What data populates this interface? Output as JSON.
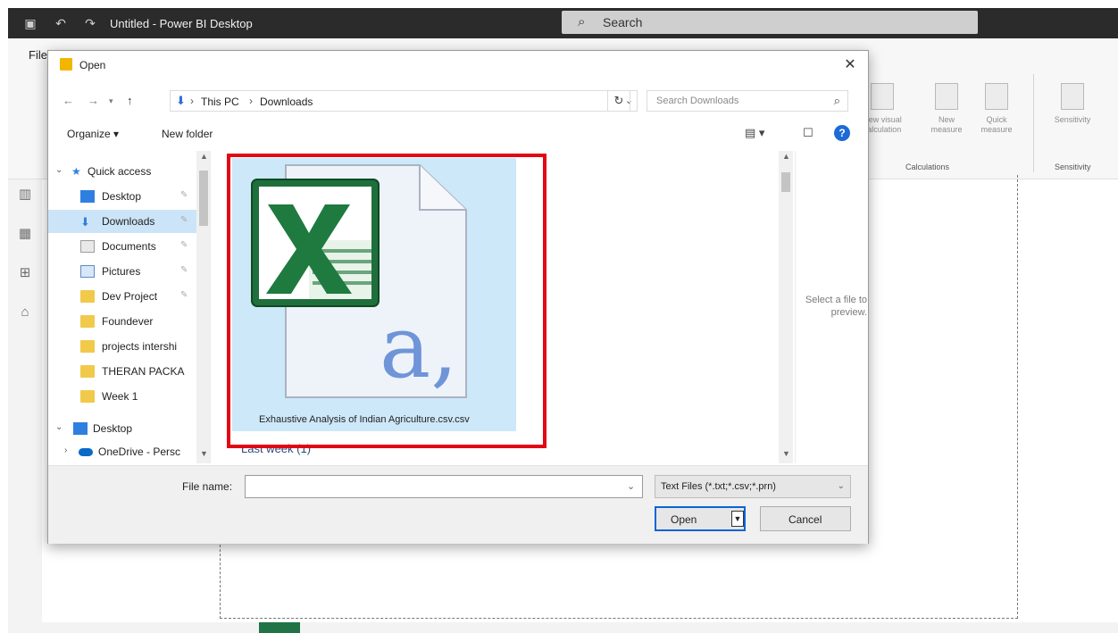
{
  "app": {
    "title": "Untitled - Power BI Desktop",
    "search_label": "Search",
    "file_tab": "File",
    "ribbon_buttons": {
      "new_visual_calc": "New visual calculation",
      "new_measure": "New measure",
      "quick_measure": "Quick measure",
      "sensitivity": "Sensitivity"
    },
    "ribbon_groups": {
      "calculations": "Calculations",
      "sensitivity": "Sensitivity"
    }
  },
  "dialog": {
    "title": "Open",
    "breadcrumb": [
      "This PC",
      "Downloads"
    ],
    "search_placeholder": "Search Downloads",
    "organize_label": "Organize ▾",
    "new_folder_label": "New folder",
    "nav_items": [
      {
        "label": "Quick access",
        "icon": "star-icon"
      },
      {
        "label": "Desktop",
        "icon": "desktop-folder-icon"
      },
      {
        "label": "Downloads",
        "icon": "download-icon"
      },
      {
        "label": "Documents",
        "icon": "documents-icon"
      },
      {
        "label": "Pictures",
        "icon": "pictures-icon"
      },
      {
        "label": "Dev Project",
        "icon": "folder-icon"
      },
      {
        "label": "Foundever",
        "icon": "folder-icon"
      },
      {
        "label": "projects intershi",
        "icon": "folder-icon"
      },
      {
        "label": "THERAN PACKA",
        "icon": "folder-icon"
      },
      {
        "label": "Week 1",
        "icon": "folder-icon"
      },
      {
        "label": "Desktop",
        "icon": "desktop-icon"
      },
      {
        "label": "OneDrive - Persc",
        "icon": "cloud-icon"
      }
    ],
    "file": {
      "name": "Exhaustive Analysis of Indian Agriculture.csv.csv",
      "icon": "excel-csv-file-icon"
    },
    "group_header": "Last week (1)",
    "preview_text": "Select a file to preview.",
    "file_name_label": "File name:",
    "file_name_value": "",
    "file_type_filter": "Text Files (*.txt;*.csv;*.prn)",
    "open_label": "Open",
    "cancel_label": "Cancel"
  },
  "colors": {
    "titlebar": "#2b2b2b",
    "selection": "#cce4f7",
    "highlight": "#e30613",
    "accent": "#0a64d8"
  }
}
